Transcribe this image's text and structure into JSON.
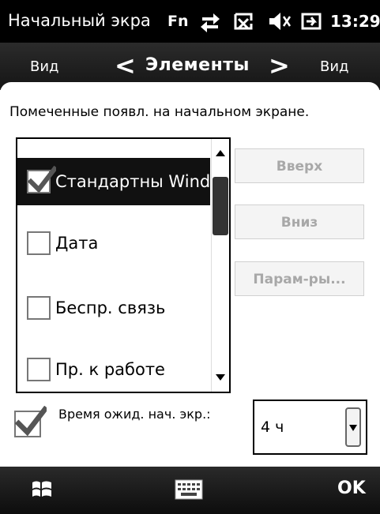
{
  "status": {
    "title": "Начальный экра",
    "fn": "Fn",
    "icons": [
      "connectivity-icon",
      "phone-off-icon",
      "speaker-mute-icon",
      "battery-charging-icon"
    ],
    "time": "13:29"
  },
  "nav": {
    "left_view": "Вид",
    "title": "Элементы",
    "right_view": "Вид",
    "prev_glyph": "<",
    "next_glyph": ">"
  },
  "description": "Помеченные появл. на начальном экране.",
  "list": {
    "items": [
      {
        "label": "Стандартны Windows",
        "checked": true,
        "selected": true
      },
      {
        "label": "Дата",
        "checked": false,
        "selected": false
      },
      {
        "label": "Беспр. связь",
        "checked": false,
        "selected": false
      },
      {
        "label": "Пр. к работе",
        "checked": false,
        "selected": false
      }
    ]
  },
  "buttons": {
    "up": "Вверх",
    "down": "Вниз",
    "params": "Парам-ры..."
  },
  "timeout": {
    "label": "Время ожид. нач. экр.:",
    "checked": true,
    "value": "4 ч"
  },
  "menu": {
    "ok": "OK"
  },
  "colors": {
    "bar_bg": "#000000",
    "selected_bg": "#111111",
    "disabled_text": "#a8a8a8"
  }
}
